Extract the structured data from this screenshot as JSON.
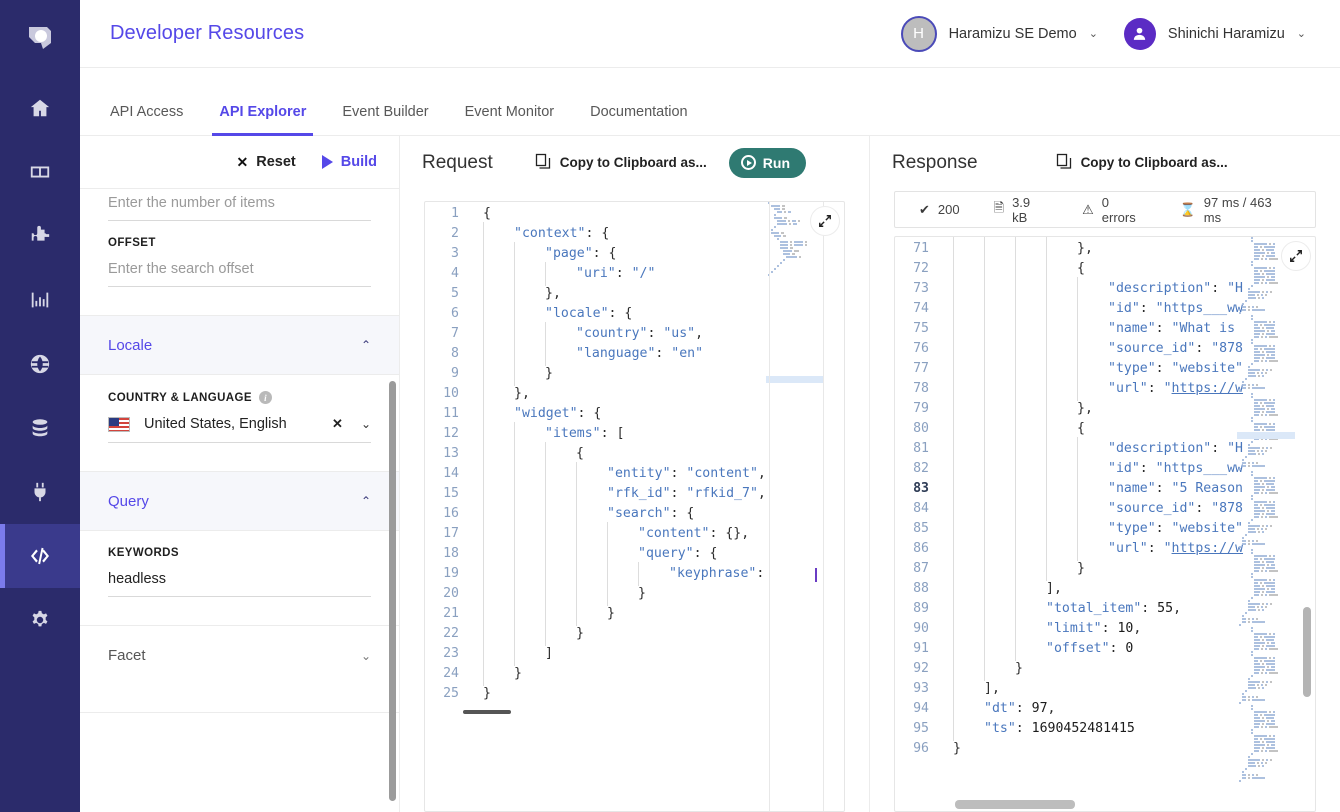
{
  "header": {
    "brand": "Developer Resources",
    "account": {
      "initial": "H",
      "name": "Haramizu SE Demo",
      "caret": "⌄"
    },
    "user": {
      "name": "Shinichi Haramizu",
      "caret": "⌄"
    }
  },
  "tabs": [
    {
      "label": "API Access",
      "active": false
    },
    {
      "label": "API Explorer",
      "active": true
    },
    {
      "label": "Event Builder",
      "active": false
    },
    {
      "label": "Event Monitor",
      "active": false
    },
    {
      "label": "Documentation",
      "active": false
    }
  ],
  "rail": {
    "items": [
      "logo-icon",
      "home-icon",
      "layout-icon",
      "puzzle-icon",
      "analytics-icon",
      "globe-icon",
      "database-icon",
      "plug-icon",
      "code-icon",
      "gear-icon"
    ]
  },
  "form": {
    "reset_label": "Reset",
    "build_label": "Build",
    "fields": [
      {
        "label": "",
        "placeholder": "Enter the number of items",
        "value": ""
      },
      {
        "label": "OFFSET",
        "placeholder": "Enter the search offset",
        "value": ""
      }
    ],
    "sections": [
      {
        "title": "Locale",
        "expanded": true,
        "caret": "⌃"
      },
      {
        "title": "Query",
        "expanded": true,
        "caret": "⌃"
      },
      {
        "title": "Facet",
        "expanded": false,
        "caret": "⌄"
      }
    ],
    "locale": {
      "label": "COUNTRY & LANGUAGE",
      "value": "United States, English",
      "clear": "✕",
      "caret": "⌄"
    },
    "query": {
      "label": "KEYWORDS",
      "value": "headless"
    }
  },
  "request": {
    "title": "Request",
    "copy_label": "Copy to Clipboard as...",
    "run_label": "Run",
    "lines": [
      {
        "n": 1,
        "indent": 0,
        "tokens": [
          {
            "t": "{",
            "c": "p"
          }
        ]
      },
      {
        "n": 2,
        "indent": 1,
        "tokens": [
          {
            "t": "\"context\"",
            "c": "k"
          },
          {
            "t": ": {",
            "c": "p"
          }
        ]
      },
      {
        "n": 3,
        "indent": 2,
        "tokens": [
          {
            "t": "\"page\"",
            "c": "k"
          },
          {
            "t": ": {",
            "c": "p"
          }
        ]
      },
      {
        "n": 4,
        "indent": 3,
        "tokens": [
          {
            "t": "\"uri\"",
            "c": "k"
          },
          {
            "t": ": ",
            "c": "p"
          },
          {
            "t": "\"/\"",
            "c": "s"
          }
        ]
      },
      {
        "n": 5,
        "indent": 2,
        "tokens": [
          {
            "t": "},",
            "c": "p"
          }
        ]
      },
      {
        "n": 6,
        "indent": 2,
        "tokens": [
          {
            "t": "\"locale\"",
            "c": "k"
          },
          {
            "t": ": {",
            "c": "p"
          }
        ]
      },
      {
        "n": 7,
        "indent": 3,
        "tokens": [
          {
            "t": "\"country\"",
            "c": "k"
          },
          {
            "t": ": ",
            "c": "p"
          },
          {
            "t": "\"us\"",
            "c": "s"
          },
          {
            "t": ",",
            "c": "p"
          }
        ]
      },
      {
        "n": 8,
        "indent": 3,
        "tokens": [
          {
            "t": "\"language\"",
            "c": "k"
          },
          {
            "t": ": ",
            "c": "p"
          },
          {
            "t": "\"en\"",
            "c": "s"
          }
        ]
      },
      {
        "n": 9,
        "indent": 2,
        "tokens": [
          {
            "t": "}",
            "c": "p"
          }
        ]
      },
      {
        "n": 10,
        "indent": 1,
        "tokens": [
          {
            "t": "},",
            "c": "p"
          }
        ]
      },
      {
        "n": 11,
        "indent": 1,
        "tokens": [
          {
            "t": "\"widget\"",
            "c": "k"
          },
          {
            "t": ": {",
            "c": "p"
          }
        ]
      },
      {
        "n": 12,
        "indent": 2,
        "tokens": [
          {
            "t": "\"items\"",
            "c": "k"
          },
          {
            "t": ": [",
            "c": "p"
          }
        ]
      },
      {
        "n": 13,
        "indent": 3,
        "tokens": [
          {
            "t": "{",
            "c": "p"
          }
        ]
      },
      {
        "n": 14,
        "indent": 4,
        "tokens": [
          {
            "t": "\"entity\"",
            "c": "k"
          },
          {
            "t": ": ",
            "c": "p"
          },
          {
            "t": "\"content\"",
            "c": "s"
          },
          {
            "t": ",",
            "c": "p"
          }
        ]
      },
      {
        "n": 15,
        "indent": 4,
        "tokens": [
          {
            "t": "\"rfk_id\"",
            "c": "k"
          },
          {
            "t": ": ",
            "c": "p"
          },
          {
            "t": "\"rfkid_7\"",
            "c": "s"
          },
          {
            "t": ",",
            "c": "p"
          }
        ]
      },
      {
        "n": 16,
        "indent": 4,
        "tokens": [
          {
            "t": "\"search\"",
            "c": "k"
          },
          {
            "t": ": {",
            "c": "p"
          }
        ]
      },
      {
        "n": 17,
        "indent": 5,
        "tokens": [
          {
            "t": "\"content\"",
            "c": "k"
          },
          {
            "t": ": {},",
            "c": "p"
          }
        ]
      },
      {
        "n": 18,
        "indent": 5,
        "tokens": [
          {
            "t": "\"query\"",
            "c": "k"
          },
          {
            "t": ": {",
            "c": "p"
          }
        ]
      },
      {
        "n": 19,
        "indent": 6,
        "tokens": [
          {
            "t": "\"keyphrase\"",
            "c": "k"
          },
          {
            "t": ":",
            "c": "p"
          }
        ]
      },
      {
        "n": 20,
        "indent": 5,
        "tokens": [
          {
            "t": "}",
            "c": "p"
          }
        ]
      },
      {
        "n": 21,
        "indent": 4,
        "tokens": [
          {
            "t": "}",
            "c": "p"
          }
        ]
      },
      {
        "n": 22,
        "indent": 3,
        "tokens": [
          {
            "t": "}",
            "c": "p"
          }
        ]
      },
      {
        "n": 23,
        "indent": 2,
        "tokens": [
          {
            "t": "]",
            "c": "p"
          }
        ]
      },
      {
        "n": 24,
        "indent": 1,
        "tokens": [
          {
            "t": "}",
            "c": "p"
          }
        ]
      },
      {
        "n": 25,
        "indent": 0,
        "tokens": [
          {
            "t": "}",
            "c": "p"
          }
        ]
      }
    ]
  },
  "response": {
    "title": "Response",
    "copy_label": "Copy to Clipboard as...",
    "status": [
      {
        "icon": "check-icon",
        "glyph": "✔",
        "text": "200"
      },
      {
        "icon": "file-icon",
        "glyph": "🗎",
        "text": "3.9 kB"
      },
      {
        "icon": "warning-icon",
        "glyph": "⚠",
        "text": "0 errors"
      },
      {
        "icon": "hourglass-icon",
        "glyph": "⌛",
        "text": "97 ms / 463 ms"
      }
    ],
    "lines": [
      {
        "n": 71,
        "indent": 4,
        "bold": false,
        "tokens": [
          {
            "t": "},",
            "c": "p"
          }
        ]
      },
      {
        "n": 72,
        "indent": 4,
        "bold": false,
        "tokens": [
          {
            "t": "{",
            "c": "p"
          }
        ]
      },
      {
        "n": 73,
        "indent": 5,
        "bold": false,
        "tokens": [
          {
            "t": "\"description\"",
            "c": "k"
          },
          {
            "t": ": ",
            "c": "p"
          },
          {
            "t": "\"H",
            "c": "s"
          }
        ]
      },
      {
        "n": 74,
        "indent": 5,
        "bold": false,
        "tokens": [
          {
            "t": "\"id\"",
            "c": "k"
          },
          {
            "t": ": ",
            "c": "p"
          },
          {
            "t": "\"https___ww",
            "c": "s"
          }
        ]
      },
      {
        "n": 75,
        "indent": 5,
        "bold": false,
        "tokens": [
          {
            "t": "\"name\"",
            "c": "k"
          },
          {
            "t": ": ",
            "c": "p"
          },
          {
            "t": "\"What is",
            "c": "s"
          }
        ]
      },
      {
        "n": 76,
        "indent": 5,
        "bold": false,
        "tokens": [
          {
            "t": "\"source_id\"",
            "c": "k"
          },
          {
            "t": ": ",
            "c": "p"
          },
          {
            "t": "\"878",
            "c": "s"
          }
        ]
      },
      {
        "n": 77,
        "indent": 5,
        "bold": false,
        "tokens": [
          {
            "t": "\"type\"",
            "c": "k"
          },
          {
            "t": ": ",
            "c": "p"
          },
          {
            "t": "\"website\"",
            "c": "s"
          }
        ]
      },
      {
        "n": 78,
        "indent": 5,
        "bold": false,
        "tokens": [
          {
            "t": "\"url\"",
            "c": "k"
          },
          {
            "t": ": ",
            "c": "p"
          },
          {
            "t": "\"",
            "c": "s"
          },
          {
            "t": "https://w",
            "c": "u"
          }
        ]
      },
      {
        "n": 79,
        "indent": 4,
        "bold": false,
        "tokens": [
          {
            "t": "},",
            "c": "p"
          }
        ]
      },
      {
        "n": 80,
        "indent": 4,
        "bold": false,
        "tokens": [
          {
            "t": "{",
            "c": "p"
          }
        ]
      },
      {
        "n": 81,
        "indent": 5,
        "bold": false,
        "tokens": [
          {
            "t": "\"description\"",
            "c": "k"
          },
          {
            "t": ": ",
            "c": "p"
          },
          {
            "t": "\"H",
            "c": "s"
          }
        ]
      },
      {
        "n": 82,
        "indent": 5,
        "bold": false,
        "tokens": [
          {
            "t": "\"id\"",
            "c": "k"
          },
          {
            "t": ": ",
            "c": "p"
          },
          {
            "t": "\"https___ww",
            "c": "s"
          }
        ]
      },
      {
        "n": 83,
        "indent": 5,
        "bold": true,
        "tokens": [
          {
            "t": "\"name\"",
            "c": "k"
          },
          {
            "t": ": ",
            "c": "p"
          },
          {
            "t": "\"5 Reason",
            "c": "s"
          }
        ]
      },
      {
        "n": 84,
        "indent": 5,
        "bold": false,
        "tokens": [
          {
            "t": "\"source_id\"",
            "c": "k"
          },
          {
            "t": ": ",
            "c": "p"
          },
          {
            "t": "\"878",
            "c": "s"
          }
        ]
      },
      {
        "n": 85,
        "indent": 5,
        "bold": false,
        "tokens": [
          {
            "t": "\"type\"",
            "c": "k"
          },
          {
            "t": ": ",
            "c": "p"
          },
          {
            "t": "\"website\"",
            "c": "s"
          }
        ]
      },
      {
        "n": 86,
        "indent": 5,
        "bold": false,
        "tokens": [
          {
            "t": "\"url\"",
            "c": "k"
          },
          {
            "t": ": ",
            "c": "p"
          },
          {
            "t": "\"",
            "c": "s"
          },
          {
            "t": "https://w",
            "c": "u"
          }
        ]
      },
      {
        "n": 87,
        "indent": 4,
        "bold": false,
        "tokens": [
          {
            "t": "}",
            "c": "p"
          }
        ]
      },
      {
        "n": 88,
        "indent": 3,
        "bold": false,
        "tokens": [
          {
            "t": "],",
            "c": "p"
          }
        ]
      },
      {
        "n": 89,
        "indent": 3,
        "bold": false,
        "tokens": [
          {
            "t": "\"total_item\"",
            "c": "k"
          },
          {
            "t": ": ",
            "c": "p"
          },
          {
            "t": "55",
            "c": "n"
          },
          {
            "t": ",",
            "c": "p"
          }
        ]
      },
      {
        "n": 90,
        "indent": 3,
        "bold": false,
        "tokens": [
          {
            "t": "\"limit\"",
            "c": "k"
          },
          {
            "t": ": ",
            "c": "p"
          },
          {
            "t": "10",
            "c": "n"
          },
          {
            "t": ",",
            "c": "p"
          }
        ]
      },
      {
        "n": 91,
        "indent": 3,
        "bold": false,
        "tokens": [
          {
            "t": "\"offset\"",
            "c": "k"
          },
          {
            "t": ": ",
            "c": "p"
          },
          {
            "t": "0",
            "c": "n"
          }
        ]
      },
      {
        "n": 92,
        "indent": 2,
        "bold": false,
        "tokens": [
          {
            "t": "}",
            "c": "p"
          }
        ]
      },
      {
        "n": 93,
        "indent": 1,
        "bold": false,
        "tokens": [
          {
            "t": "],",
            "c": "p"
          }
        ]
      },
      {
        "n": 94,
        "indent": 1,
        "bold": false,
        "tokens": [
          {
            "t": "\"dt\"",
            "c": "k"
          },
          {
            "t": ": ",
            "c": "p"
          },
          {
            "t": "97",
            "c": "n"
          },
          {
            "t": ",",
            "c": "p"
          }
        ]
      },
      {
        "n": 95,
        "indent": 1,
        "bold": false,
        "tokens": [
          {
            "t": "\"ts\"",
            "c": "k"
          },
          {
            "t": ": ",
            "c": "p"
          },
          {
            "t": "1690452481415",
            "c": "n"
          }
        ]
      },
      {
        "n": 96,
        "indent": 0,
        "bold": false,
        "tokens": [
          {
            "t": "}",
            "c": "p"
          }
        ]
      }
    ]
  },
  "colors": {
    "brand_purple": "#5548e8",
    "rail_bg": "#2b2b6b",
    "rail_active": "#3a3a8c",
    "rail_accent": "#7b7bec",
    "run_teal": "#2f7a72",
    "code_blue": "#4a77bd"
  }
}
